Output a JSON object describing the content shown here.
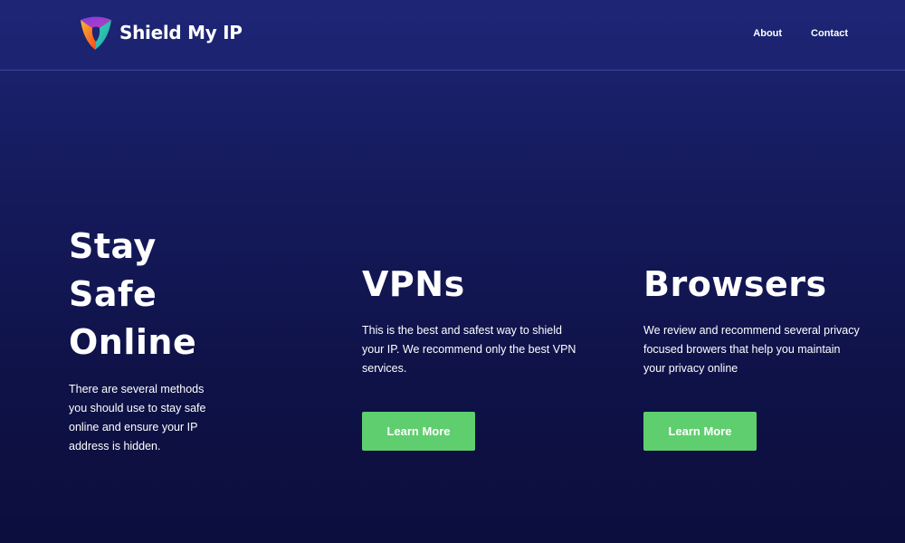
{
  "header": {
    "brand": "Shield My IP",
    "logo_icon": "shield-logo-icon",
    "nav": [
      {
        "label": "About"
      },
      {
        "label": "Contact"
      }
    ]
  },
  "hero": {
    "title_lines": [
      "Stay",
      "Safe",
      "Online"
    ],
    "text": "There are several methods you should use to stay safe online and ensure your IP address is hidden."
  },
  "cards": [
    {
      "title": "VPNs",
      "text": "This is the best and safest way to shield your IP. We recommend only the best VPN services.",
      "button": "Learn More"
    },
    {
      "title": "Browsers",
      "text": "We review and recommend several privacy focused browers that help you maintain your privacy online",
      "button": "Learn More"
    }
  ],
  "colors": {
    "background_top": "#1e2573",
    "background_bottom": "#0c0e3d",
    "button": "#5fce6e",
    "text": "#ffffff"
  }
}
